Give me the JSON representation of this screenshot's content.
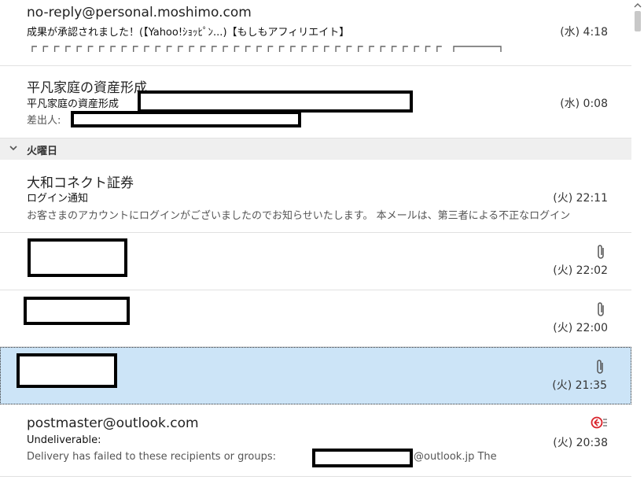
{
  "messages": [
    {
      "sender": "no-reply@personal.moshimo.com",
      "subject": "成果が承認されました！(【Yahoo!ｼｮｯﾋﾟﾝ...)【もしもアフィリエイト】",
      "preview": "",
      "time": "(水) 4:18",
      "attachment": false,
      "selected": false
    },
    {
      "sender": "平凡家庭の資産形成",
      "subject": "平凡家庭の資産形成",
      "preview_label": "差出人:",
      "time": "(水) 0:08",
      "attachment": false,
      "selected": false
    },
    {
      "sender": "大和コネクト証券",
      "subject": "ログイン通知",
      "preview": "お客さまのアカウントにログインがございましたのでお知らせいたします。 本メールは、第三者による不正なログイン",
      "time": "(火) 22:11",
      "attachment": false,
      "selected": false
    },
    {
      "sender": "",
      "time": "(火) 22:02",
      "attachment": true,
      "selected": false
    },
    {
      "sender": "",
      "time": "(火) 22:00",
      "attachment": true,
      "selected": false
    },
    {
      "sender": "",
      "time": "(火) 21:35",
      "attachment": true,
      "selected": true
    },
    {
      "sender": "postmaster@outlook.com",
      "subject": "Undeliverable:",
      "preview_prefix": "Delivery has failed to these recipients or groups:",
      "preview_suffix": "@outlook.jp  The",
      "time": "(火) 20:38",
      "attachment": false,
      "selected": false,
      "icon": "reply-icon"
    }
  ],
  "group_header": {
    "label": "火曜日",
    "expanded": true
  },
  "colors": {
    "selected_bg": "#cce4f7",
    "group_bg": "#efefef",
    "redaction": "#000000"
  }
}
